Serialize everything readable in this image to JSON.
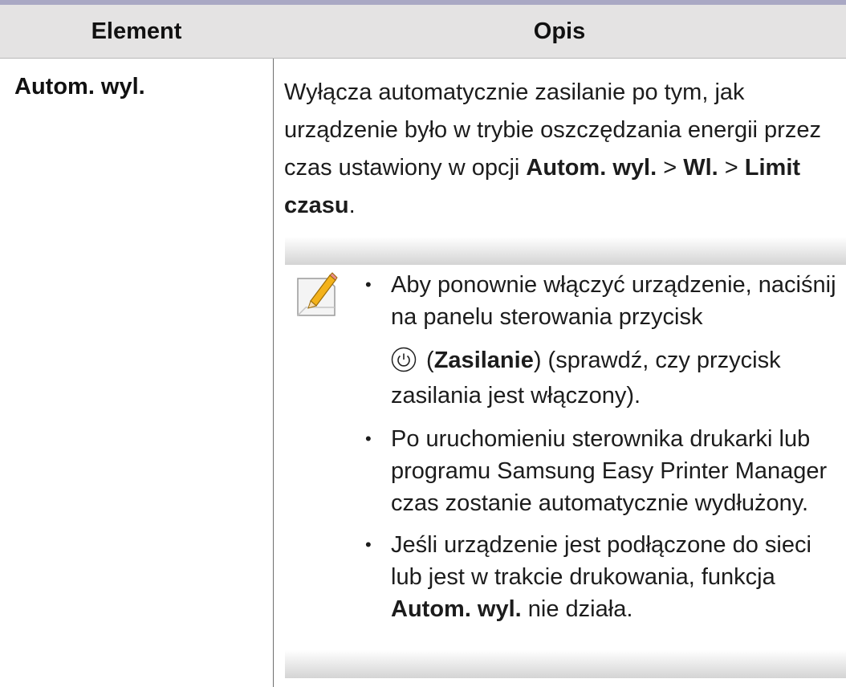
{
  "table": {
    "header": {
      "element": "Element",
      "description": "Opis"
    },
    "row": {
      "element": "Autom. wyl.",
      "description": {
        "text1": "Wyłącza automatycznie zasilanie po tym, jak urządzenie było w trybie oszczędzania energii przez czas ustawiony w opcji ",
        "b1": "Autom. wyl.",
        "sep1": " > ",
        "b2": "Wl.",
        "sep2": " > ",
        "b3": "Limit czasu",
        "end": "."
      }
    }
  },
  "note": {
    "icon": "note-pencil-icon",
    "bullet_glyph": "•",
    "item1": {
      "text": "Aby ponownie włączyć urządzenie, naciśnij na panelu sterowania przycisk",
      "power_icon": "power-icon",
      "open_paren": " (",
      "bold": "Zasilanie",
      "after_bold": ") (sprawdź, czy przycisk",
      "last_line": "zasilania jest włączony)."
    },
    "item2": {
      "text1": "Po uruchomieniu sterownika drukarki lub programu ",
      "app": "Samsung Easy Printer Manager",
      "text2": " czas zostanie automatycznie wydłużony."
    },
    "item3": {
      "text1": "Jeśli urządzenie jest podłączone do sieci lub jest w trakcie drukowania, funkcja ",
      "bold": "Autom. wyl.",
      "text2": " nie działa."
    }
  },
  "colors": {
    "rule": "#a9a8c4",
    "header_bg": "#e4e3e3",
    "note_bar": "#d4d4d4"
  }
}
